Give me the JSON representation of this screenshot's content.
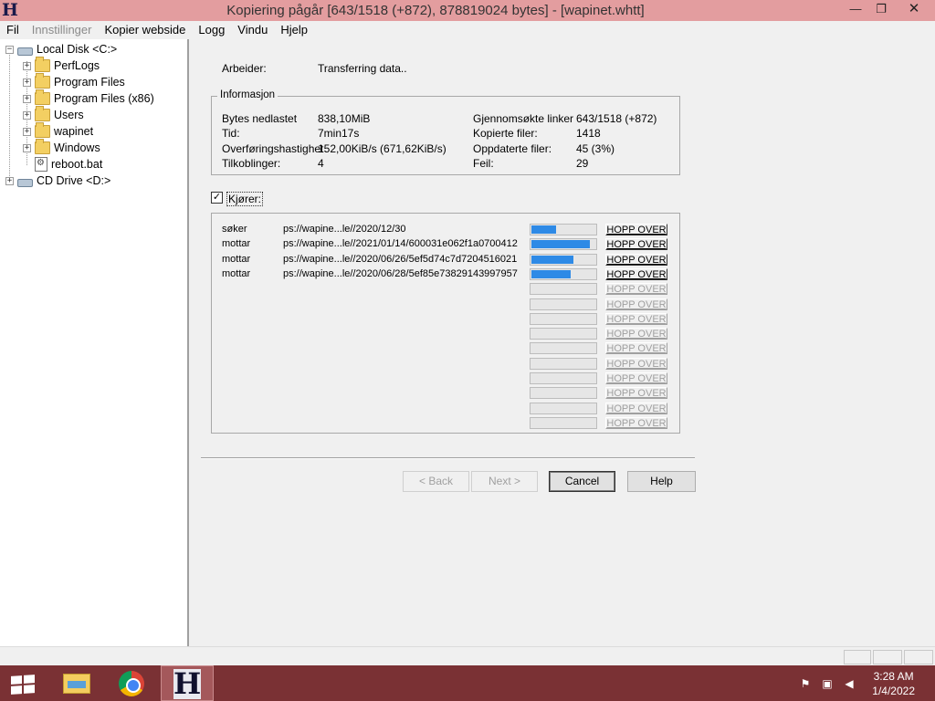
{
  "window": {
    "title": "Kopiering pågår [643/1518 (+872), 878819024 bytes] - [wapinet.whtt]",
    "app_icon_letter": "H",
    "minimize_glyph": "—",
    "maximize_glyph": "❐",
    "close_glyph": "✕"
  },
  "menu": {
    "items": [
      {
        "label": "Fil",
        "enabled": true
      },
      {
        "label": "Innstillinger",
        "enabled": false
      },
      {
        "label": "Kopier webside",
        "enabled": true
      },
      {
        "label": "Logg",
        "enabled": true
      },
      {
        "label": "Vindu",
        "enabled": true
      },
      {
        "label": "Hjelp",
        "enabled": true
      }
    ]
  },
  "tree": {
    "root1": {
      "label": "Local Disk <C:>",
      "icon": "disk-icon",
      "expander": "−"
    },
    "children": [
      {
        "label": "PerfLogs",
        "icon": "folder-icon",
        "expander": "+"
      },
      {
        "label": "Program Files",
        "icon": "folder-icon",
        "expander": "+"
      },
      {
        "label": "Program Files (x86)",
        "icon": "folder-icon",
        "expander": "+"
      },
      {
        "label": "Users",
        "icon": "folder-icon",
        "expander": "+"
      },
      {
        "label": "wapinet",
        "icon": "folder-icon",
        "expander": "+"
      },
      {
        "label": "Windows",
        "icon": "folder-icon",
        "expander": "+"
      },
      {
        "label": "reboot.bat",
        "icon": "batch-file-icon",
        "expander": ""
      }
    ],
    "root2": {
      "label": "CD Drive <D:>",
      "icon": "cd-drive-icon",
      "expander": "+"
    }
  },
  "main": {
    "worker_label": "Arbeider:",
    "worker_value": "Transferring data..",
    "info": {
      "title": "Informasjon",
      "left": [
        {
          "label": "Bytes nedlastet",
          "value": "838,10MiB"
        },
        {
          "label": "Tid:",
          "value": "7min17s"
        },
        {
          "label": "Overføringshastighet",
          "value": "152,00KiB/s (671,62KiB/s)"
        },
        {
          "label": "Tilkoblinger:",
          "value": "4"
        }
      ],
      "right": [
        {
          "label": "Gjennomsøkte linker",
          "value": "643/1518 (+872)"
        },
        {
          "label": "Kopierte filer:",
          "value": "1418"
        },
        {
          "label": "Oppdaterte filer:",
          "value": "45 (3%)"
        },
        {
          "label": "Feil:",
          "value": "29"
        }
      ]
    },
    "running": {
      "label": "Kjører:",
      "checked": true,
      "check_glyph": "✓"
    },
    "transfers": [
      {
        "status": "søker",
        "url": "ps://wapine...le//2020/12/30",
        "progress": 0.38
      },
      {
        "status": "mottar",
        "url": "ps://wapine...le//2021/01/14/600031e062f1a0700412",
        "progress": 0.92
      },
      {
        "status": "mottar",
        "url": "ps://wapine...le//2020/06/26/5ef5d74c7d7204516021",
        "progress": 0.65
      },
      {
        "status": "mottar",
        "url": "ps://wapine...le//2020/06/28/5ef85e73829143997957",
        "progress": 0.62
      },
      {
        "status": "",
        "url": "",
        "progress": 0
      },
      {
        "status": "",
        "url": "",
        "progress": 0
      },
      {
        "status": "",
        "url": "",
        "progress": 0
      },
      {
        "status": "",
        "url": "",
        "progress": 0
      },
      {
        "status": "",
        "url": "",
        "progress": 0
      },
      {
        "status": "",
        "url": "",
        "progress": 0
      },
      {
        "status": "",
        "url": "",
        "progress": 0
      },
      {
        "status": "",
        "url": "",
        "progress": 0
      },
      {
        "status": "",
        "url": "",
        "progress": 0
      },
      {
        "status": "",
        "url": "",
        "progress": 0
      }
    ],
    "skip_label": "HOPP OVER",
    "progress_color": "#2e8ae6",
    "buttons": {
      "back": "< Back",
      "next": "Next >",
      "cancel": "Cancel",
      "help": "Help"
    }
  },
  "taskbar": {
    "apps": [
      {
        "name": "start",
        "icon": "windows-logo-icon"
      },
      {
        "name": "file-explorer",
        "icon": "folder-icon"
      },
      {
        "name": "chrome",
        "icon": "chrome-icon"
      },
      {
        "name": "httrack",
        "icon": "httrack-icon",
        "letter": "H",
        "active": true
      }
    ],
    "tray": [
      "action-center-flag-icon",
      "network-icon",
      "volume-muted-icon"
    ],
    "time": "3:28 AM",
    "date": "1/4/2022",
    "color": "#7a3134"
  }
}
